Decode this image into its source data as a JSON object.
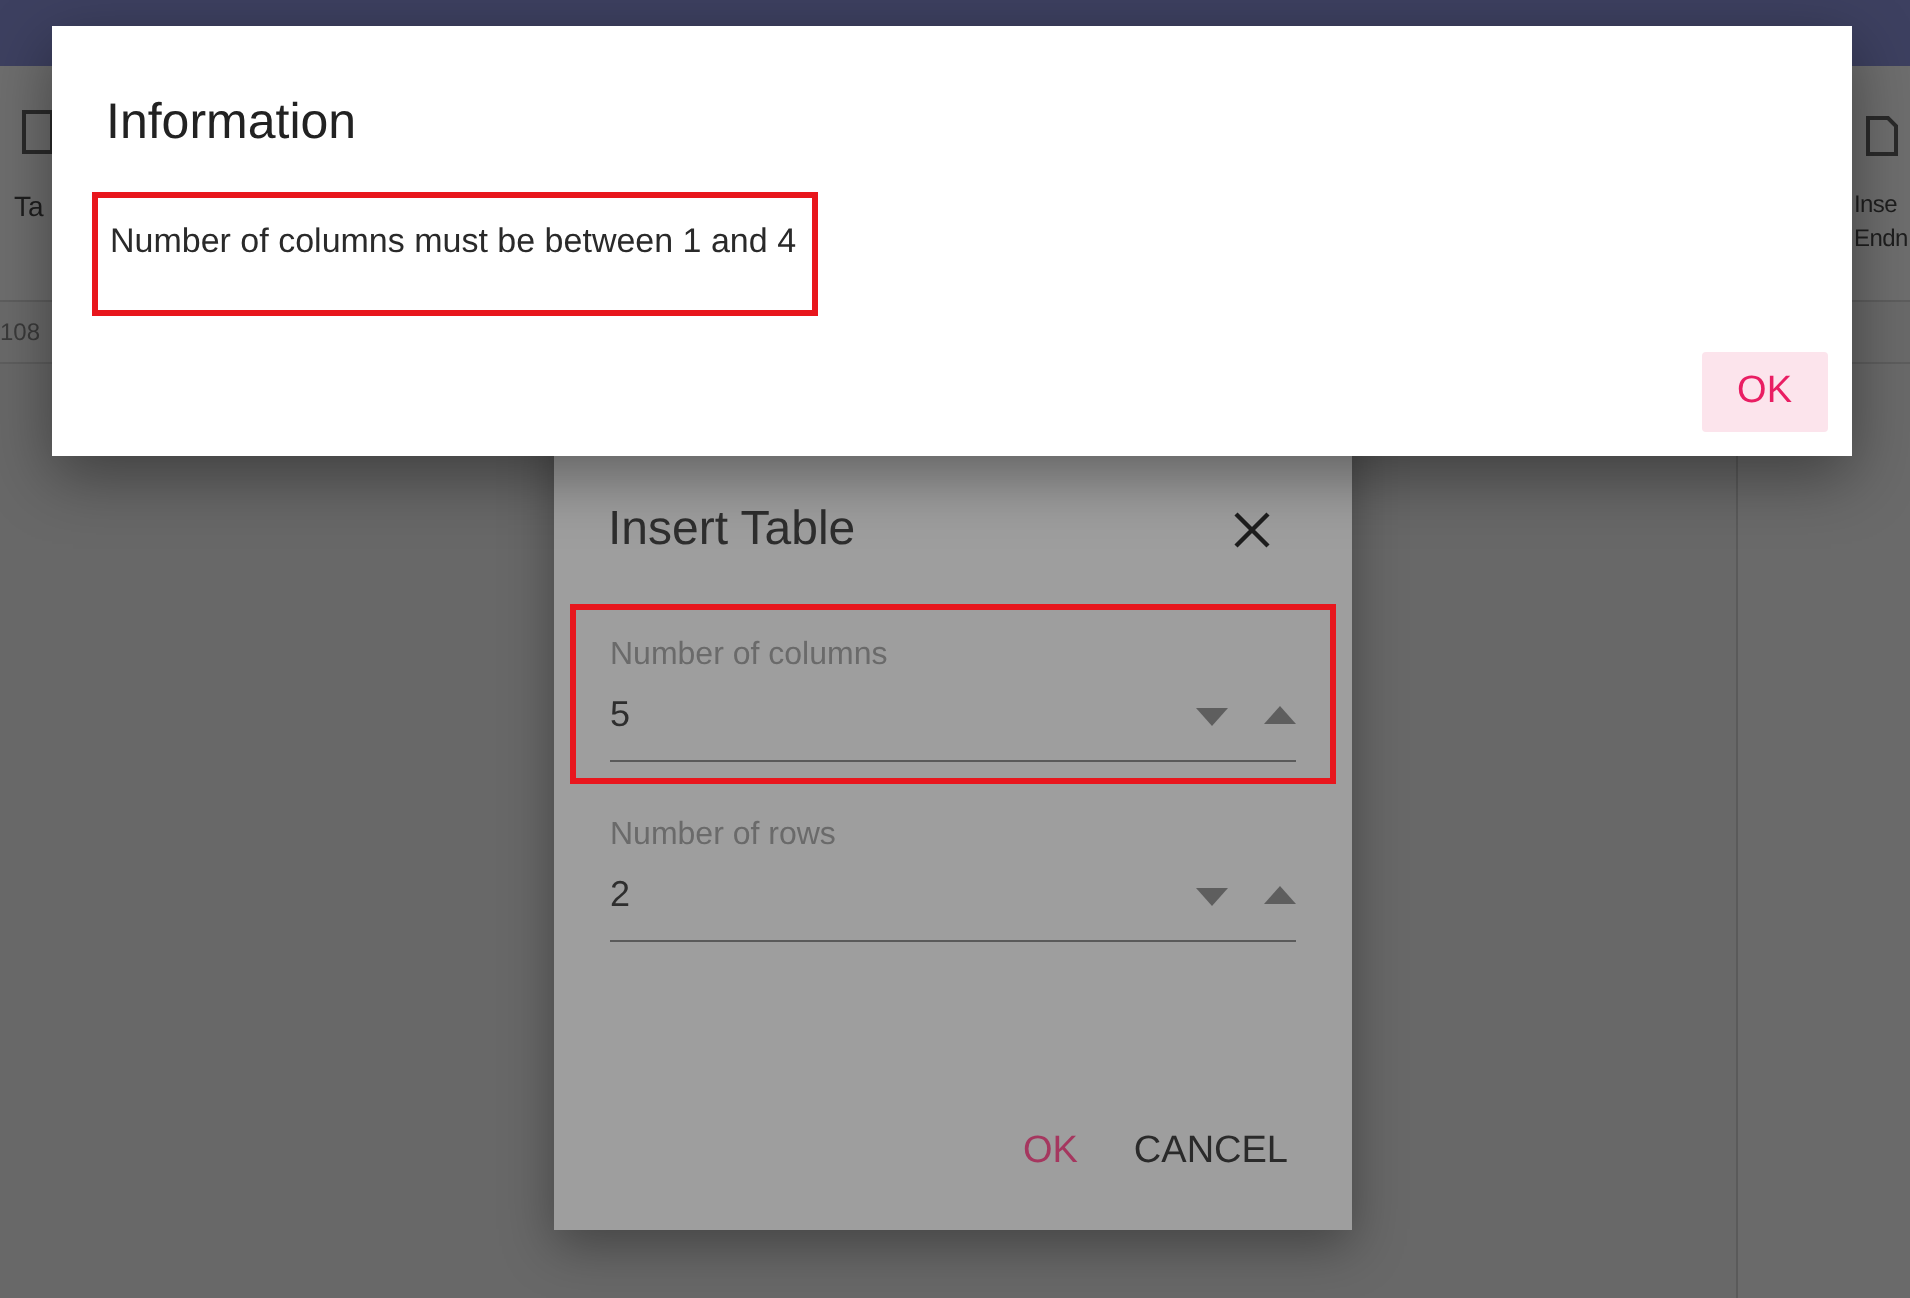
{
  "app": {
    "toolbar_left": {
      "label": "Ta"
    },
    "toolbar_right": {
      "lines": [
        "Inse",
        "Endn"
      ]
    },
    "ruler": "108"
  },
  "insert_table_dialog": {
    "title": "Insert Table",
    "fields": [
      {
        "label": "Number of columns",
        "value": "5",
        "highlighted": true
      },
      {
        "label": "Number of rows",
        "value": "2",
        "highlighted": false
      }
    ],
    "buttons": [
      {
        "label": "OK",
        "kind": "primary"
      },
      {
        "label": "CANCEL",
        "kind": "secondary"
      }
    ]
  },
  "information_dialog": {
    "title": "Information",
    "message": "Number of columns must be between 1 and 4",
    "message_highlighted": true,
    "button": "OK"
  }
}
